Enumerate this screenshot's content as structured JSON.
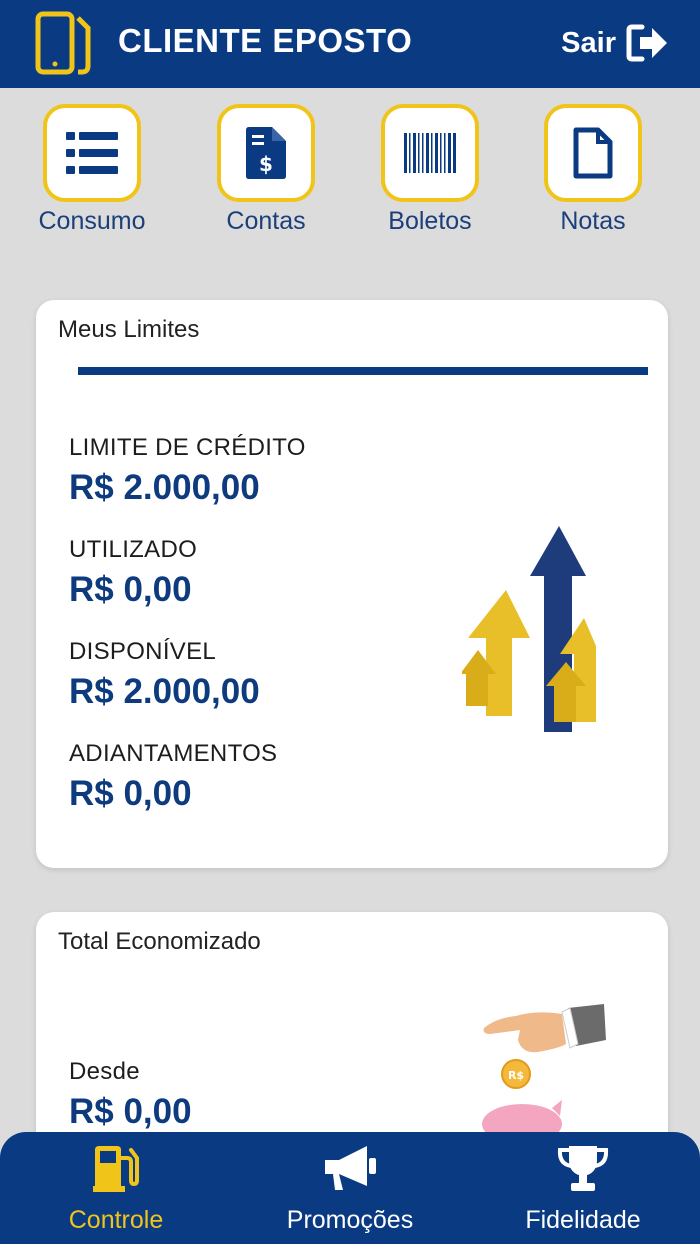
{
  "header": {
    "title": "CLIENTE EPOSTO",
    "logout_label": "Sair",
    "logo_icon": "phone-fuel-icon",
    "logout_icon": "sign-out-icon"
  },
  "shortcuts": [
    {
      "label": "Consumo",
      "icon": "list-icon"
    },
    {
      "label": "Contas",
      "icon": "invoice-dollar-icon"
    },
    {
      "label": "Boletos",
      "icon": "barcode-icon"
    },
    {
      "label": "Notas",
      "icon": "document-icon"
    }
  ],
  "limits_card": {
    "title": "Meus Limites",
    "items": [
      {
        "label": "LIMITE DE CRÉDITO",
        "value": "R$ 2.000,00"
      },
      {
        "label": "UTILIZADO",
        "value": "R$ 0,00"
      },
      {
        "label": "DISPONÍVEL",
        "value": "R$ 2.000,00"
      },
      {
        "label": "ADIANTAMENTOS",
        "value": "R$ 0,00"
      }
    ],
    "illustration": "growth-arrows-icon"
  },
  "savings_card": {
    "title": "Total Economizado",
    "label": "Desde",
    "value": "R$ 0,00",
    "illustration": "hand-coin-piggy-bank-icon",
    "coin_text": "R$"
  },
  "bottom_nav": [
    {
      "label": "Controle",
      "icon": "fuel-pump-icon",
      "active": true
    },
    {
      "label": "Promoções",
      "icon": "megaphone-icon",
      "active": false
    },
    {
      "label": "Fidelidade",
      "icon": "trophy-icon",
      "active": false
    }
  ],
  "colors": {
    "primary": "#0a3a82",
    "accent": "#f0c419",
    "background": "#dcdcdc",
    "value_text": "#0d3b7e"
  }
}
